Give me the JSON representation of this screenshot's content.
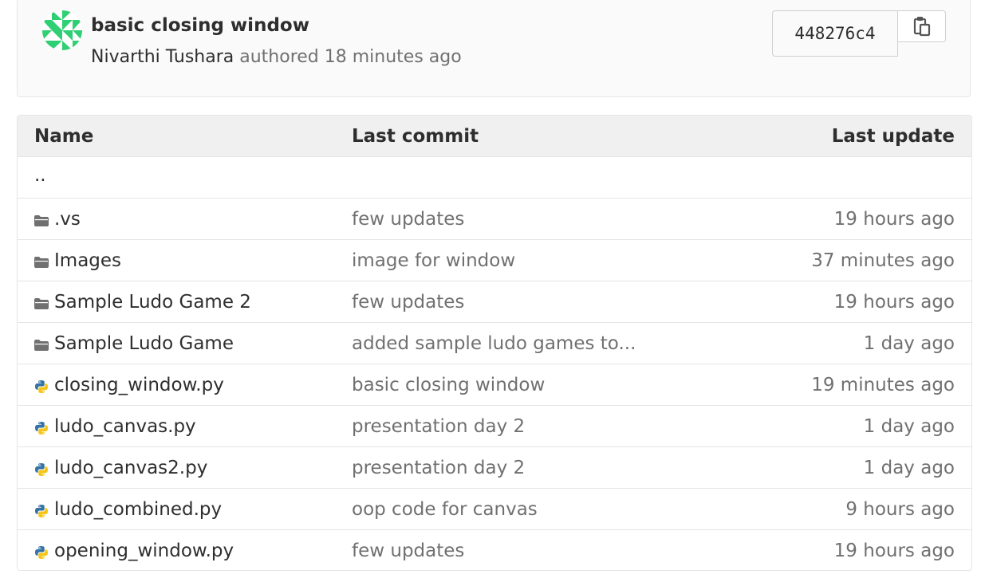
{
  "commit": {
    "title": "basic closing window",
    "author": "Nivarthi Tushara",
    "authored_text": "authored",
    "time": "18 minutes ago",
    "sha": "448276c4",
    "copy_icon": "clipboard-icon",
    "avatar_icon": "identicon-avatar",
    "avatar_color": "#2fcf74"
  },
  "tree": {
    "headers": {
      "name": "Name",
      "last_commit": "Last commit",
      "last_update": "Last update"
    },
    "parent": "..",
    "rows": [
      {
        "name": ".vs",
        "type": "folder",
        "icon": "folder-icon",
        "commit": "few updates",
        "updated": "19 hours ago"
      },
      {
        "name": "Images",
        "type": "folder",
        "icon": "folder-icon",
        "commit": "image for window",
        "updated": "37 minutes ago"
      },
      {
        "name": "Sample Ludo Game 2",
        "type": "folder",
        "icon": "folder-icon",
        "commit": "few updates",
        "updated": "19 hours ago"
      },
      {
        "name": "Sample Ludo Game",
        "type": "folder",
        "icon": "folder-icon",
        "commit": "added sample ludo games to...",
        "updated": "1 day ago"
      },
      {
        "name": "closing_window.py",
        "type": "python",
        "icon": "python-file-icon",
        "commit": "basic closing window",
        "updated": "19 minutes ago"
      },
      {
        "name": "ludo_canvas.py",
        "type": "python",
        "icon": "python-file-icon",
        "commit": "presentation day 2",
        "updated": "1 day ago"
      },
      {
        "name": "ludo_canvas2.py",
        "type": "python",
        "icon": "python-file-icon",
        "commit": "presentation day 2",
        "updated": "1 day ago"
      },
      {
        "name": "ludo_combined.py",
        "type": "python",
        "icon": "python-file-icon",
        "commit": "oop code for canvas",
        "updated": "9 hours ago"
      },
      {
        "name": "opening_window.py",
        "type": "python",
        "icon": "python-file-icon",
        "commit": "few updates",
        "updated": "19 hours ago"
      }
    ]
  },
  "colors": {
    "folder": "#707070",
    "python_blue": "#3572a5",
    "python_yellow": "#f5c518"
  }
}
